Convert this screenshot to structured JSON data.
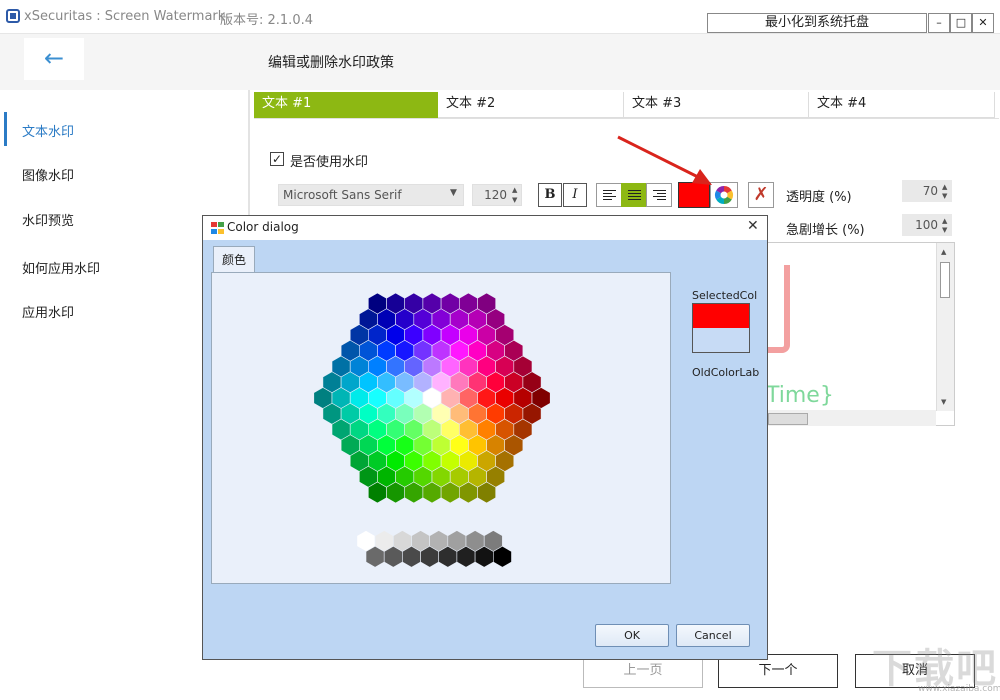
{
  "window": {
    "title": "xSecuritas : Screen Watermark",
    "version": "版本号: 2.1.0.4",
    "minimize_tray": "最小化到系统托盘",
    "min_glyph": "–",
    "max_glyph": "□",
    "close_glyph": "✕"
  },
  "header": {
    "back_glyph": "←",
    "title": "编辑或删除水印政策"
  },
  "sidebar": {
    "items": [
      {
        "label": "文本水印"
      },
      {
        "label": "图像水印"
      },
      {
        "label": "水印预览"
      },
      {
        "label": "如何应用水印"
      },
      {
        "label": "应用水印"
      }
    ]
  },
  "tabs": [
    "文本 #1",
    "文本 #2",
    "文本 #3",
    "文本 #4"
  ],
  "editor": {
    "use_watermark_label": "是否使用水印",
    "use_watermark_checked": true,
    "font_name": "Microsoft Sans Serif",
    "font_size": "120",
    "bold": "B",
    "italic": "I",
    "color": "#ff0000",
    "opacity_label": "透明度 (%)",
    "opacity_value": "70",
    "surge_label": "急剧增长 (%)",
    "surge_value": "100",
    "preview_text": "Time}"
  },
  "nav": {
    "prev": "上一页",
    "next": "下一个",
    "cancel": "取消"
  },
  "dialog": {
    "title": "Color dialog",
    "close_glyph": "✕",
    "tab": "颜色",
    "selected_label": "SelectedCol",
    "old_label": "OldColorLab",
    "ok": "OK",
    "cancel": "Cancel",
    "selected_color": "#ff0000"
  },
  "watermark": {
    "brand": "下载吧",
    "url": "www.xiazaiba.com"
  }
}
